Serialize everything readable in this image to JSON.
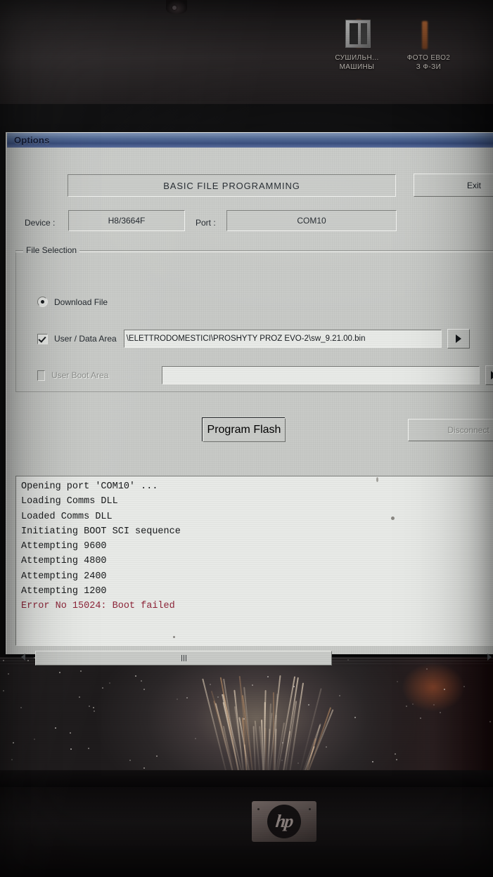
{
  "desktop": {
    "icons": [
      {
        "label_line1": "СУШИЛЬН...",
        "label_line2": "МАШИНЫ",
        "icon": "folder-icon"
      },
      {
        "label_line1": "ФОТО ЕВО2",
        "label_line2": "З Ф-ЗИ",
        "icon": "folder-icon"
      }
    ]
  },
  "hardware": {
    "brand": "hp"
  },
  "window": {
    "title": "Options",
    "header_title": "BASIC FILE PROGRAMMING",
    "exit_label": "Exit",
    "device": {
      "label": "Device :",
      "value": "H8/3664F"
    },
    "port": {
      "label": "Port :",
      "value": "COM10"
    },
    "file_selection": {
      "legend": "File Selection",
      "download_file": {
        "label": "Download File",
        "selected": true,
        "icon": "radio-selected-icon"
      },
      "user_data_area": {
        "label": "User / Data Area",
        "checked": true,
        "enabled": true,
        "path": "\\ELETTRODOMESTICI\\PROSHYTY PROZ EVO-2\\sw_9.21.00.bin",
        "browse_icon": "browse-arrow-icon"
      },
      "user_boot_area": {
        "label": "User Boot Area",
        "checked": false,
        "enabled": false,
        "path": "",
        "browse_icon": "browse-arrow-icon"
      }
    },
    "program_flash_label": "Program Flash",
    "disconnect_label": "Disconnect",
    "disconnect_enabled": false,
    "log": {
      "lines": [
        {
          "text": "Opening port 'COM10' ...",
          "type": "info"
        },
        {
          "text": "Loading Comms DLL",
          "type": "info"
        },
        {
          "text": "Loaded Comms DLL",
          "type": "info"
        },
        {
          "text": "Initiating BOOT SCI sequence",
          "type": "info"
        },
        {
          "text": "Attempting 9600",
          "type": "info"
        },
        {
          "text": "Attempting 4800",
          "type": "info"
        },
        {
          "text": "Attempting 2400",
          "type": "info"
        },
        {
          "text": "Attempting 1200",
          "type": "info"
        },
        {
          "text": "Error No 15024: Boot failed",
          "type": "error"
        }
      ],
      "error_color": "#8d2438",
      "text_color": "#16181a"
    },
    "scrollbars": {
      "vertical": {
        "up_icon": "scroll-up-arrow-icon",
        "down_icon": "scroll-down-arrow-icon"
      },
      "horizontal": {
        "left_icon": "scroll-left-arrow-icon",
        "right_icon": "scroll-right-arrow-icon"
      }
    }
  },
  "colors": {
    "titlebar_accent": "#34497a",
    "window_face": "#c8cac7",
    "error": "#8d2438"
  }
}
